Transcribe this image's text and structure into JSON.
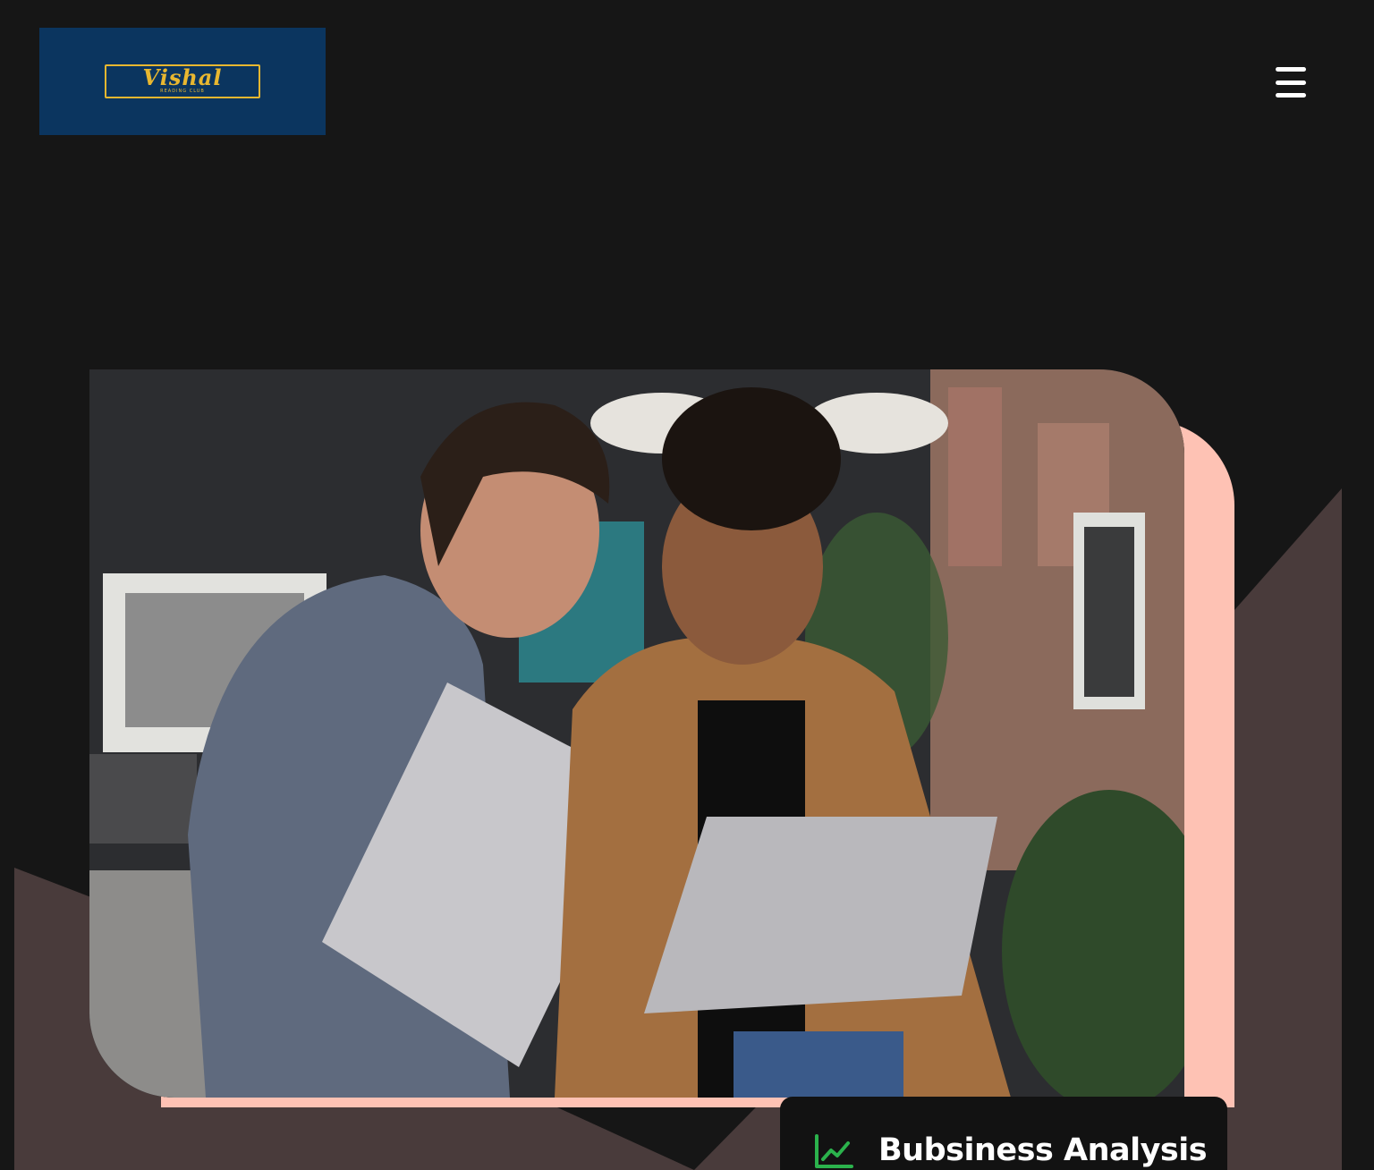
{
  "brand": {
    "logo_text": "Vishal",
    "logo_subtext": "READING CLUB",
    "colors": {
      "logo_bg": "#0b355f",
      "logo_gold": "#e8b730"
    }
  },
  "header": {
    "menu_icon": "hamburger-menu-icon"
  },
  "hero": {
    "image_alt": "Two colleagues smiling while looking at a laptop",
    "colors": {
      "accent_pink": "#fec2b4",
      "shape_brown": "#493b3b",
      "page_bg": "#161616"
    }
  },
  "feature_card": {
    "icon": "line-chart-icon",
    "icon_color": "#2bb24c",
    "title": "Bubsiness Analysis"
  }
}
